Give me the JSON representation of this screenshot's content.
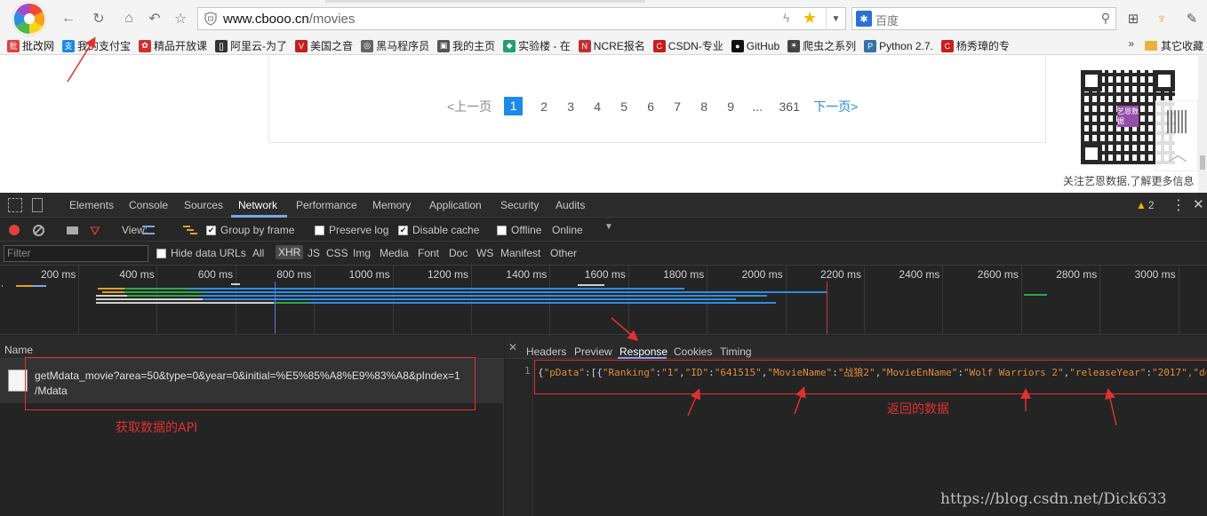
{
  "browser": {
    "url_domain": "www.cbooo.cn",
    "url_path": "/movies",
    "search_placeholder": "百度",
    "bookmarks": [
      {
        "label": "批改网",
        "icon": "pigai-icon",
        "color": "#e04040"
      },
      {
        "label": "我的支付宝",
        "icon": "alipay-icon",
        "color": "#1a8ae5"
      },
      {
        "label": "精品开放课",
        "icon": "course-icon",
        "color": "#d03030"
      },
      {
        "label": "阿里云-为了",
        "icon": "aliyun-icon",
        "color": "#333333"
      },
      {
        "label": "美国之音",
        "icon": "voa-icon",
        "color": "#c02020"
      },
      {
        "label": "黑马程序员",
        "icon": "heima-icon",
        "color": "#666666"
      },
      {
        "label": "我的主页",
        "icon": "home-page-icon",
        "color": "#555555"
      },
      {
        "label": "实验楼 - 在",
        "icon": "shiyanlou-icon",
        "color": "#20a070"
      },
      {
        "label": "NCRE报名",
        "icon": "ncre-icon",
        "color": "#c03030"
      },
      {
        "label": "CSDN-专业",
        "icon": "csdn-icon",
        "color": "#c81d1d"
      },
      {
        "label": "GitHub",
        "icon": "github-icon",
        "color": "#111111"
      },
      {
        "label": "爬虫之系列",
        "icon": "spider-icon",
        "color": "#444444"
      },
      {
        "label": "Python 2.7.",
        "icon": "python-icon",
        "color": "#3572a5"
      },
      {
        "label": "杨秀璋的专",
        "icon": "blog-icon",
        "color": "#c81d1d"
      }
    ],
    "bookmarks_more": "»",
    "bookmarks_other": "其它收藏"
  },
  "page": {
    "pager": {
      "prev": "<上一页",
      "pages": [
        "1",
        "2",
        "3",
        "4",
        "5",
        "6",
        "7",
        "8",
        "9",
        "...",
        "361"
      ],
      "active_index": 0,
      "next": "下一页>"
    },
    "qr_badge": "艺恩数据",
    "qr_caption": "关注艺恩数据,了解更多信息"
  },
  "devtools": {
    "tabs": [
      "Elements",
      "Console",
      "Sources",
      "Network",
      "Performance",
      "Memory",
      "Application",
      "Security",
      "Audits"
    ],
    "active_tab": "Network",
    "warnings": "2",
    "controls": {
      "view_label": "View:",
      "group_by_frame": "Group by frame",
      "preserve_log": "Preserve log",
      "disable_cache": "Disable cache",
      "offline": "Offline",
      "online": "Online"
    },
    "filter": {
      "placeholder": "Filter",
      "hide_data_urls": "Hide data URLs",
      "types": [
        "All",
        "XHR",
        "JS",
        "CSS",
        "Img",
        "Media",
        "Font",
        "Doc",
        "WS",
        "Manifest",
        "Other"
      ],
      "active_type": "XHR"
    },
    "timeline_ticks": [
      "200 ms",
      "400 ms",
      "600 ms",
      "800 ms",
      "1000 ms",
      "1200 ms",
      "1400 ms",
      "1600 ms",
      "1800 ms",
      "2000 ms",
      "2200 ms",
      "2400 ms",
      "2600 ms",
      "2800 ms",
      "3000 ms"
    ],
    "requests_header": "Name",
    "request": {
      "line1": "getMdata_movie?area=50&type=0&year=0&initial=%E5%85%A8%E9%83%A8&pIndex=1",
      "line2": "/Mdata"
    },
    "detail_tabs": [
      "Headers",
      "Preview",
      "Response",
      "Cookies",
      "Timing"
    ],
    "active_detail_tab": "Response",
    "response": {
      "line_number": "1",
      "pdata_key": "\"pData\"",
      "ranking_key": "\"Ranking\"",
      "ranking_value": "\"1\"",
      "id_key": "\"ID\"",
      "id_value": "\"641515\"",
      "moviename_key": "\"MovieName\"",
      "moviename_value": "\"战狼2\"",
      "movieenname_key": "\"MovieEnName\"",
      "movieenname_value": "\"Wolf Warriors 2\"",
      "releaseyear_key": "\"releaseYear\"",
      "releaseyear_value": "\"2017\"",
      "tail": ",\"de"
    }
  },
  "annotations": {
    "api_label": "获取数据的API",
    "data_label": "返回的数据",
    "color": "#e03030"
  },
  "watermark": "https://blog.csdn.net/Dick633"
}
